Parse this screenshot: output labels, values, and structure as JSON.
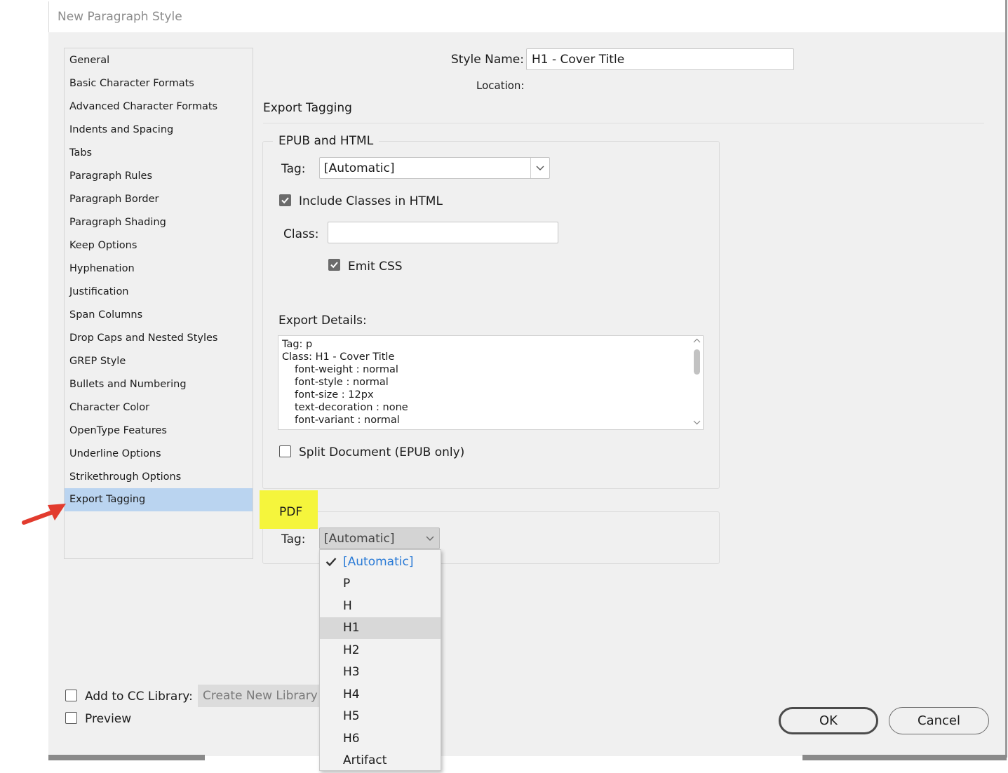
{
  "dialog": {
    "title": "New Paragraph Style"
  },
  "categories": [
    "General",
    "Basic Character Formats",
    "Advanced Character Formats",
    "Indents and Spacing",
    "Tabs",
    "Paragraph Rules",
    "Paragraph Border",
    "Paragraph Shading",
    "Keep Options",
    "Hyphenation",
    "Justification",
    "Span Columns",
    "Drop Caps and Nested Styles",
    "GREP Style",
    "Bullets and Numbering",
    "Character Color",
    "OpenType Features",
    "Underline Options",
    "Strikethrough Options",
    "Export Tagging"
  ],
  "selected_category": "Export Tagging",
  "style_name": {
    "label": "Style Name:",
    "value": "H1 - Cover Title"
  },
  "location_label": "Location:",
  "section_title": "Export Tagging",
  "epub": {
    "group_title": "EPUB and HTML",
    "tag_label": "Tag:",
    "tag_value": "[Automatic]",
    "include_classes_label": "Include Classes in HTML",
    "include_classes_checked": true,
    "class_label": "Class:",
    "class_value": "",
    "emit_css_label": "Emit CSS",
    "emit_css_checked": true,
    "details_label": "Export Details:",
    "details_lines": [
      "Tag: p",
      "Class: H1 - Cover Title",
      "font-weight : normal",
      "font-style : normal",
      "font-size : 12px",
      "text-decoration : none",
      "font-variant : normal"
    ],
    "split_label": "Split Document (EPUB only)",
    "split_checked": false
  },
  "pdf": {
    "group_title": "PDF",
    "tag_label": "Tag:",
    "tag_value": "[Automatic]",
    "options": [
      "[Automatic]",
      "P",
      "H",
      "H1",
      "H2",
      "H3",
      "H4",
      "H5",
      "H6",
      "Artifact"
    ],
    "selected_option": "[Automatic]",
    "hovered_option": "H1"
  },
  "footer": {
    "cc_library_label": "Add to CC Library:",
    "cc_library_checked": false,
    "create_library_label": "Create New Library",
    "preview_label": "Preview",
    "preview_checked": false,
    "ok_label": "OK",
    "cancel_label": "Cancel"
  },
  "colors": {
    "selection": "#bad4f0",
    "highlight": "#f5f53c",
    "link_blue": "#2b7bd6",
    "annotation_arrow": "#e23b2e"
  },
  "icons": {
    "annotation": "red-arrow-icon",
    "dropdown": "chevron-down-icon",
    "check": "checkmark-icon"
  }
}
